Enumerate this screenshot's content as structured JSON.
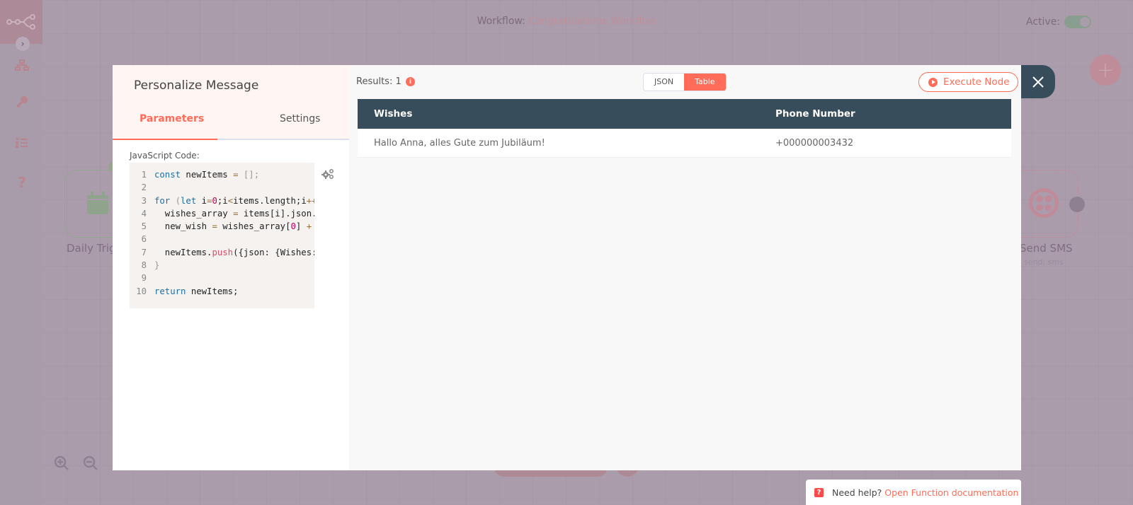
{
  "header": {
    "workflow_prefix": "Workflow:",
    "workflow_name": "Congratulations Workflow",
    "active_label": "Active:",
    "active": true
  },
  "sidebar": {
    "items": [
      {
        "icon": "network-icon",
        "label": "Workflows"
      },
      {
        "icon": "key-icon",
        "label": "Credentials"
      },
      {
        "icon": "checklist-icon",
        "label": "Executions"
      },
      {
        "icon": "help-icon",
        "label": "Help"
      }
    ]
  },
  "canvas": {
    "nodes": [
      {
        "name": "Daily Trig",
        "subtitle": ""
      },
      {
        "name": "Send SMS",
        "subtitle": "send: sms"
      }
    ]
  },
  "modal": {
    "node_title": "Personalize Message",
    "tabs": [
      {
        "label": "Parameters",
        "active": true
      },
      {
        "label": "Settings",
        "active": false
      }
    ],
    "field_label": "JavaScript Code:",
    "code_lines": [
      "1",
      "2",
      "3",
      "4",
      "5",
      "6",
      "7",
      "8",
      "9",
      "10"
    ],
    "code": {
      "l1_kw": "const",
      "l1_rest": " newItems ",
      "l1_op": "=",
      "l1_br": " [];",
      "l3_kw1": "for",
      "l3_p": " (",
      "l3_kw2": "let",
      "l3_a": " i",
      "l3_eq": "=",
      "l3_zero": "0",
      "l3_b": ";i",
      "l3_lt": "<",
      "l3_c": "items.length;i",
      "l3_pp": "++",
      "l4_a": "  wishes_array ",
      "l4_eq": "=",
      "l4_b": " items[i].json.",
      "l5_a": "  new_wish ",
      "l5_eq": "=",
      "l5_b": " wishes_array[",
      "l5_zero": "0",
      "l5_c": "] ",
      "l5_plus": "+",
      "l7_a": "  newItems.",
      "l7_fn": "push",
      "l7_b": "({json: {Wishes:",
      "l8": "}",
      "l10_kw": "return",
      "l10_rest": " newItems;"
    },
    "results_label": "Results: 1",
    "view_toggle": [
      {
        "label": "JSON",
        "active": false
      },
      {
        "label": "Table",
        "active": true
      }
    ],
    "execute_label": "Execute Node",
    "table": {
      "columns": [
        "Wishes",
        "Phone Number"
      ],
      "rows": [
        [
          "Hallo Anna, alles Gute zum Jubiläum!",
          "+000000003432"
        ]
      ]
    }
  },
  "help": {
    "prompt": "Need help?",
    "link": "Open Function documentation"
  },
  "colors": {
    "accent": "#ff6d5a",
    "header_dark": "#384d5c",
    "overlay": "#aa9cab"
  }
}
